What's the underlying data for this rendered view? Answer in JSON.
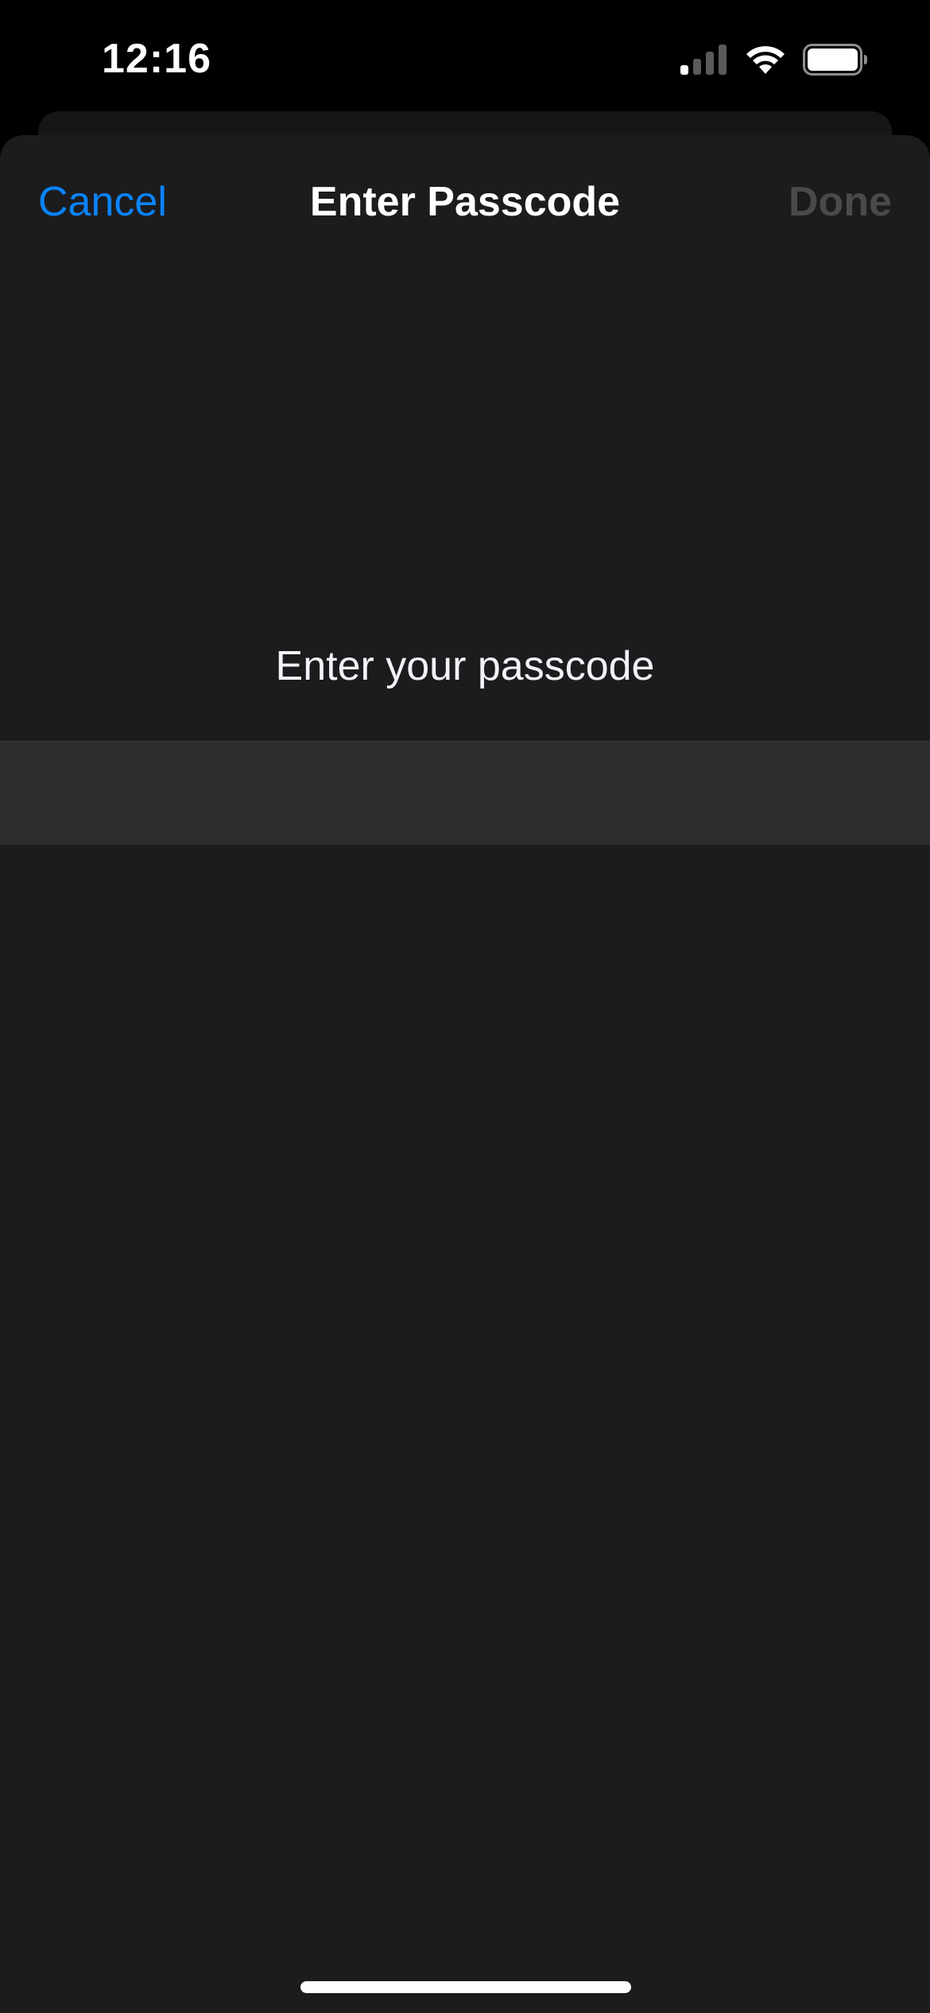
{
  "status_bar": {
    "time": "12:16",
    "signal_icon": "cellular-signal-icon",
    "wifi_icon": "wifi-icon",
    "battery_icon": "battery-icon"
  },
  "nav": {
    "cancel_label": "Cancel",
    "title": "Enter Passcode",
    "done_label": "Done"
  },
  "prompt": {
    "text": "Enter your passcode"
  },
  "passcode_field": {
    "value": "",
    "placeholder": ""
  },
  "colors": {
    "accent": "#0a84ff",
    "background": "#1c1c1e",
    "field_background": "#2c2c2e",
    "disabled_text": "#4a4a4c"
  }
}
